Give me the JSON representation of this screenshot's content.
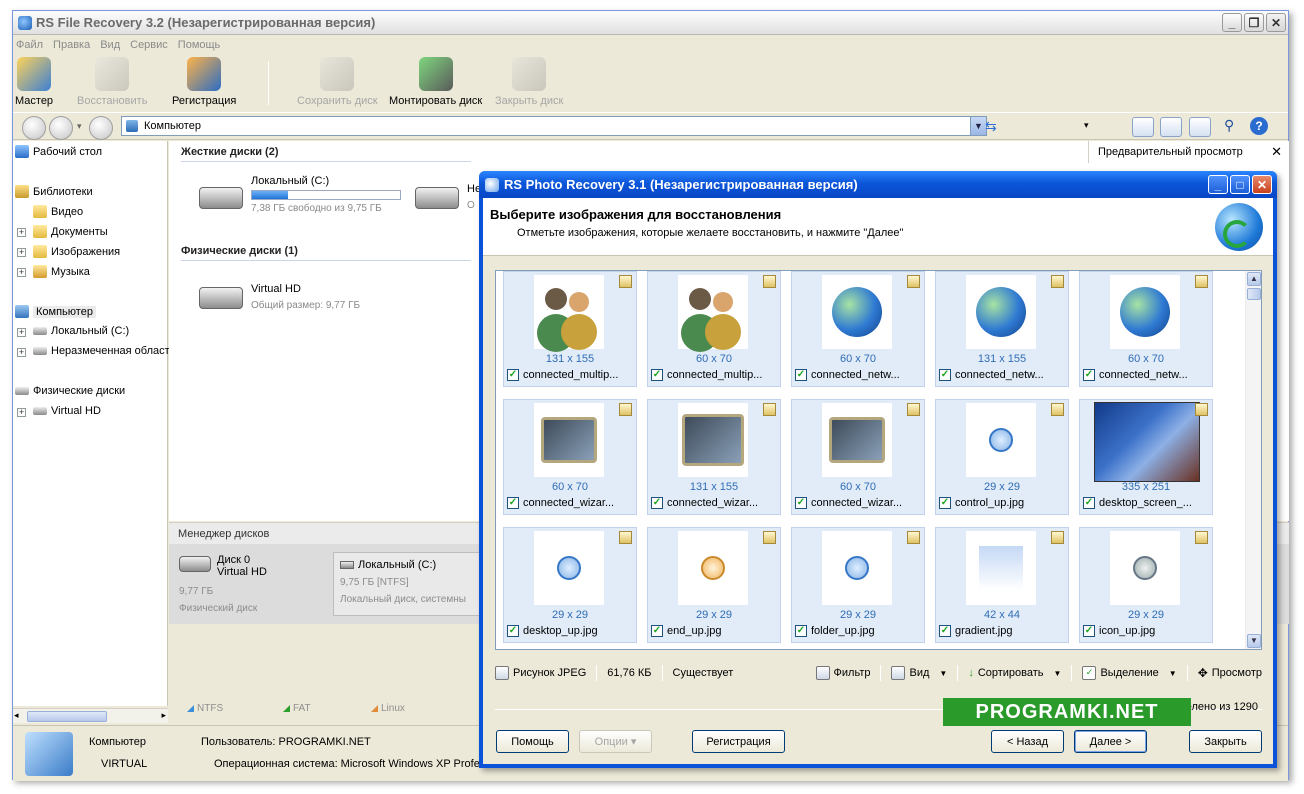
{
  "main_window": {
    "title": "RS File Recovery 3.2 (Незарегистрированная версия)",
    "menu": [
      "Файл",
      "Правка",
      "Вид",
      "Сервис",
      "Помощь"
    ],
    "toolbar": {
      "wizard": "Мастер",
      "restore": "Восстановить",
      "register": "Регистрация",
      "save_disk": "Сохранить диск",
      "mount_disk": "Монтировать диск",
      "close_disk": "Закрыть диск"
    },
    "address": "Компьютер",
    "tree": {
      "desktop": "Рабочий стол",
      "libraries": "Библиотеки",
      "video": "Видео",
      "documents": "Документы",
      "images": "Изображения",
      "music": "Музыка",
      "computer": "Компьютер",
      "local_c": "Локальный (C:)",
      "unallocated": "Неразмеченная област",
      "physical": "Физические диски",
      "virtual_hd": "Virtual HD"
    },
    "hard_disks_header": "Жесткие диски (2)",
    "disk_c": {
      "name": "Локальный (C:)",
      "free": "7,38 ГБ свободно из 9,75 ГБ",
      "used_fraction": 0.24
    },
    "disk_second_partial": {
      "name": "Не",
      "sub": "О"
    },
    "physical_header": "Физические диски (1)",
    "virtual_hd": {
      "name": "Virtual HD",
      "size": "Общий размер: 9,77 ГБ"
    },
    "preview_title": "Предварительный просмотр",
    "disk_manager": {
      "title": "Менеджер дисков",
      "disk0_name": "Диск 0",
      "disk0_model": "Virtual HD",
      "disk0_size": "9,77 ГБ",
      "disk0_type": "Физический диск",
      "part_name": "Локальный (C:)",
      "part_fs": "9,75 ГБ [NTFS]",
      "part_type": "Локальный диск, системны"
    },
    "legend": [
      "NTFS",
      "FAT",
      "Linux"
    ],
    "status": {
      "computer": "Компьютер",
      "virtual": "VIRTUAL",
      "user": "Пользователь: PROGRAMKI.NET",
      "os": "Операционная система: Microsoft Windows XP Profes"
    },
    "colors": {
      "legend_ntfs": "#3a8fd8",
      "legend_fat": "#2ca02c",
      "legend_linux": "#e08a3c"
    }
  },
  "dialog": {
    "title": "RS Photo Recovery 3.1 (Незарегистрированная версия)",
    "heading": "Выберите изображения для восстановления",
    "subheading": "Отметьте изображения, которые желаете восстановить, и нажмите \"Далее\"",
    "tiles": [
      {
        "dims": "131 x 155",
        "name": "connected_multip...",
        "img": "people"
      },
      {
        "dims": "60 x 70",
        "name": "connected_multip...",
        "img": "people"
      },
      {
        "dims": "60 x 70",
        "name": "connected_netw...",
        "img": "globe"
      },
      {
        "dims": "131 x 155",
        "name": "connected_netw...",
        "img": "globe"
      },
      {
        "dims": "60 x 70",
        "name": "connected_netw...",
        "img": "globe"
      },
      {
        "dims": "60 x 70",
        "name": "connected_wizar...",
        "img": "chart"
      },
      {
        "dims": "131 x 155",
        "name": "connected_wizar...",
        "img": "chart"
      },
      {
        "dims": "60 x 70",
        "name": "connected_wizar...",
        "img": "chart"
      },
      {
        "dims": "29 x 29",
        "name": "control_up.jpg",
        "img": "small"
      },
      {
        "dims": "335 x 251",
        "name": "desktop_screen_...",
        "img": "desktop"
      },
      {
        "dims": "29 x 29",
        "name": "desktop_up.jpg",
        "img": "small"
      },
      {
        "dims": "29 x 29",
        "name": "end_up.jpg",
        "img": "small-orange"
      },
      {
        "dims": "29 x 29",
        "name": "folder_up.jpg",
        "img": "small"
      },
      {
        "dims": "42 x 44",
        "name": "gradient.jpg",
        "img": "gradient"
      },
      {
        "dims": "29 x 29",
        "name": "icon_up.jpg",
        "img": "small-gray"
      }
    ],
    "info": {
      "type": "Рисунок JPEG",
      "size": "61,76 КБ",
      "status": "Существует",
      "filter": "Фильтр",
      "view": "Вид",
      "sort": "Сортировать",
      "selection": "Выделение",
      "preview": "Просмотр"
    },
    "selection_count": "елено из 1290",
    "watermark": "PROGRAMKI.NET",
    "buttons": {
      "help": "Помощь",
      "options": "Опции ▾",
      "register": "Регистрация",
      "back": "< Назад",
      "next": "Далее >",
      "close": "Закрыть"
    }
  }
}
